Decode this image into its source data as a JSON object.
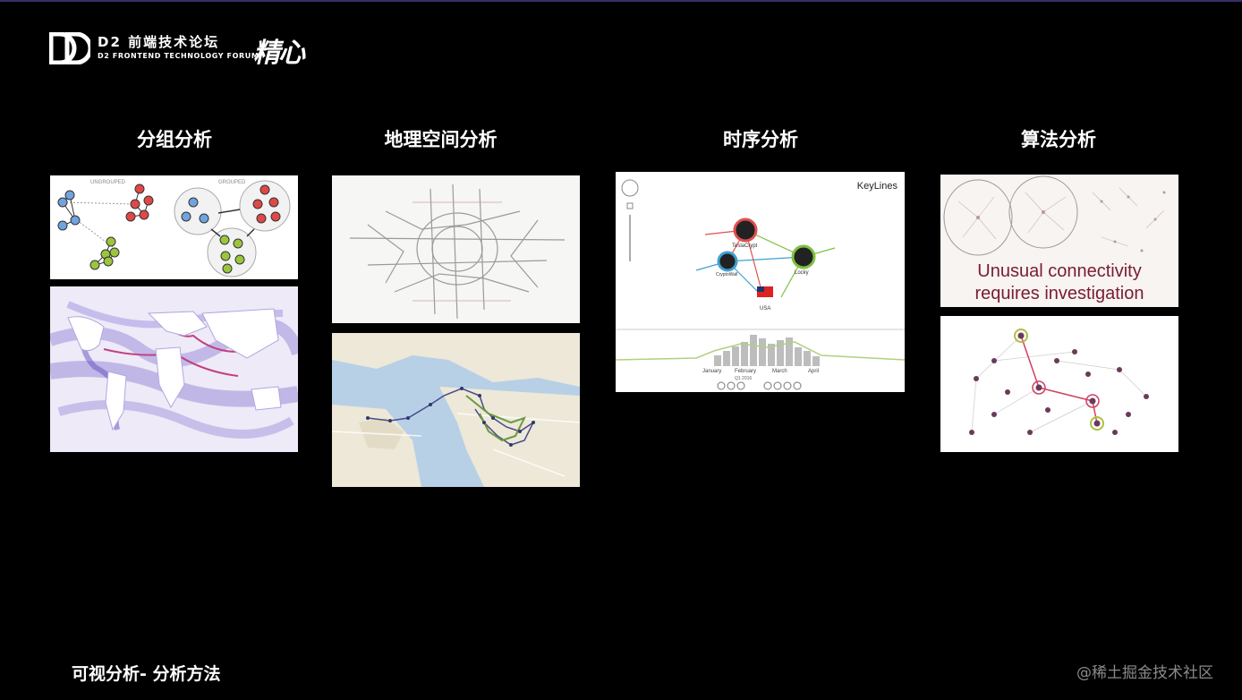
{
  "header": {
    "logo_cn": "D2 前端技术论坛",
    "logo_en": "D2 FRONTEND TECHNOLOGY FORUM",
    "brand": "精心"
  },
  "columns": [
    {
      "title": "分组分析"
    },
    {
      "title": "地理空间分析"
    },
    {
      "title": "时序分析"
    },
    {
      "title": "算法分析"
    }
  ],
  "panels": {
    "grouping": {
      "left_label": "UNGROUPED",
      "right_label": "GROUPED"
    },
    "timeline": {
      "brand": "KeyLines",
      "node_labels": [
        "TeslaCrypt",
        "CryptoWall",
        "Locky",
        "USA"
      ],
      "months": [
        "January",
        "February",
        "March",
        "April"
      ],
      "quarter": "Q1 2016"
    },
    "algorithm": {
      "caption_line1": "Unusual connectivity",
      "caption_line2": "requires investigation"
    }
  },
  "footer": {
    "title": "可视分析- 分析方法",
    "watermark": "@稀土掘金技术社区"
  },
  "colors": {
    "background": "#000000",
    "accent_line": "#3a2d6b",
    "group_red": "#e04848",
    "group_blue": "#6fa4e0",
    "group_green": "#9bc53d"
  }
}
